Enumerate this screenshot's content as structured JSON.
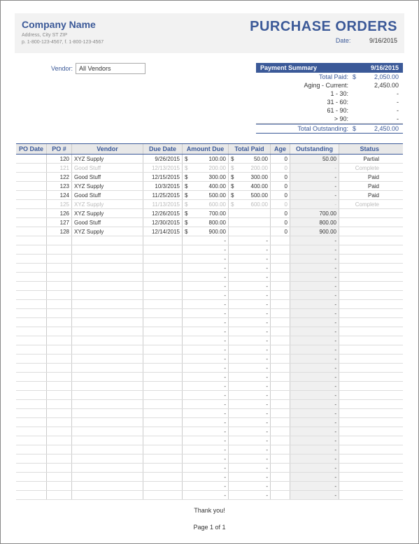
{
  "header": {
    "company_name": "Company Name",
    "address": "Address, City ST ZIP",
    "phone": "p. 1-800-123-4567, f. 1-800-123-4567",
    "title": "PURCHASE ORDERS",
    "date_label": "Date:",
    "date_value": "9/16/2015"
  },
  "vendor": {
    "label": "Vendor:",
    "value": "All Vendors"
  },
  "summary": {
    "heading": "Payment Summary",
    "heading_date": "9/16/2015",
    "rows": [
      {
        "label": "Total Paid:",
        "dollar": "$",
        "value": "2,050.00",
        "blue": true
      },
      {
        "label": "Aging - Current:",
        "dollar": "",
        "value": "2,450.00",
        "blue": false
      },
      {
        "label": "1 - 30:",
        "dollar": "",
        "value": "-",
        "blue": false
      },
      {
        "label": "31 - 60:",
        "dollar": "",
        "value": "-",
        "blue": false
      },
      {
        "label": "61 - 90:",
        "dollar": "",
        "value": "-",
        "blue": false
      },
      {
        "label": "> 90:",
        "dollar": "",
        "value": "-",
        "blue": false
      }
    ],
    "total_label": "Total Outstanding:",
    "total_dollar": "$",
    "total_value": "2,450.00"
  },
  "columns": {
    "podate": "PO Date",
    "ponum": "PO #",
    "vendor": "Vendor",
    "due": "Due Date",
    "amt": "Amount Due",
    "paid": "Total Paid",
    "age": "Age",
    "out": "Outstanding",
    "status": "Status"
  },
  "rows": [
    {
      "podate": "",
      "ponum": "120",
      "vendor": "XYZ Supply",
      "due": "9/26/2015",
      "amt_d": "$",
      "amt": "100.00",
      "paid_d": "$",
      "paid": "50.00",
      "age": "0",
      "out": "50.00",
      "status": "Partial",
      "complete": false
    },
    {
      "podate": "",
      "ponum": "121",
      "vendor": "Good Stuff",
      "due": "12/13/2015",
      "amt_d": "$",
      "amt": "200.00",
      "paid_d": "$",
      "paid": "200.00",
      "age": "0",
      "out": "-",
      "status": "Complete",
      "complete": true
    },
    {
      "podate": "",
      "ponum": "122",
      "vendor": "Good Stuff",
      "due": "12/15/2015",
      "amt_d": "$",
      "amt": "300.00",
      "paid_d": "$",
      "paid": "300.00",
      "age": "0",
      "out": "-",
      "status": "Paid",
      "complete": false
    },
    {
      "podate": "",
      "ponum": "123",
      "vendor": "XYZ Supply",
      "due": "10/3/2015",
      "amt_d": "$",
      "amt": "400.00",
      "paid_d": "$",
      "paid": "400.00",
      "age": "0",
      "out": "-",
      "status": "Paid",
      "complete": false
    },
    {
      "podate": "",
      "ponum": "124",
      "vendor": "Good Stuff",
      "due": "11/25/2015",
      "amt_d": "$",
      "amt": "500.00",
      "paid_d": "$",
      "paid": "500.00",
      "age": "0",
      "out": "-",
      "status": "Paid",
      "complete": false
    },
    {
      "podate": "",
      "ponum": "125",
      "vendor": "XYZ Supply",
      "due": "11/13/2015",
      "amt_d": "$",
      "amt": "600.00",
      "paid_d": "$",
      "paid": "600.00",
      "age": "0",
      "out": "-",
      "status": "Complete",
      "complete": true
    },
    {
      "podate": "",
      "ponum": "126",
      "vendor": "XYZ Supply",
      "due": "12/26/2015",
      "amt_d": "$",
      "amt": "700.00",
      "paid_d": "",
      "paid": "",
      "age": "0",
      "out": "700.00",
      "status": "",
      "complete": false
    },
    {
      "podate": "",
      "ponum": "127",
      "vendor": "Good Stuff",
      "due": "12/30/2015",
      "amt_d": "$",
      "amt": "800.00",
      "paid_d": "",
      "paid": "",
      "age": "0",
      "out": "800.00",
      "status": "",
      "complete": false
    },
    {
      "podate": "",
      "ponum": "128",
      "vendor": "XYZ Supply",
      "due": "12/14/2015",
      "amt_d": "$",
      "amt": "900.00",
      "paid_d": "",
      "paid": "",
      "age": "0",
      "out": "900.00",
      "status": "",
      "complete": false
    }
  ],
  "empty_row_count": 29,
  "footer": {
    "thanks": "Thank you!",
    "page": "Page 1 of 1"
  }
}
